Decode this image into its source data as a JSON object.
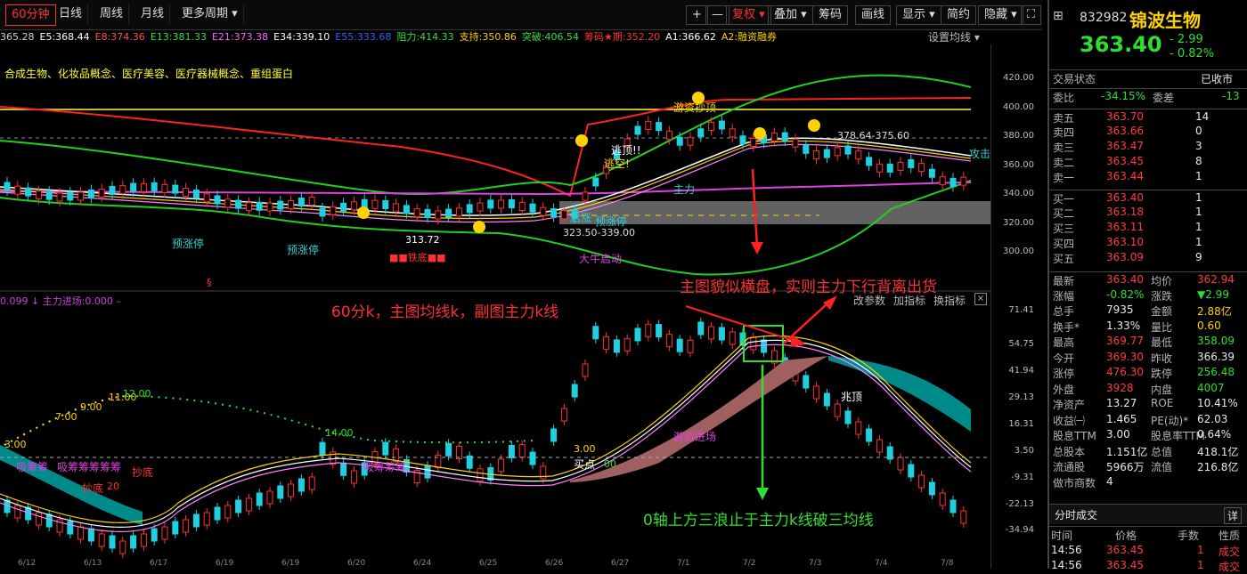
{
  "toolbar": {
    "periods": [
      "60分钟",
      "日线",
      "周线",
      "月线",
      "更多周期 ▾"
    ],
    "buttons": [
      "+",
      "—",
      "复权 ▾",
      "叠加 ▾",
      "筹码",
      "画线",
      "显示 ▾",
      "简约",
      "隐藏 ▾"
    ],
    "colors": {
      "active": "#ff3030"
    }
  },
  "ma_row": [
    {
      "text": "365.28",
      "color": "#d0d0d0"
    },
    {
      "text": "E5:368.44",
      "color": "#ffffff"
    },
    {
      "text": "E8:374.36",
      "color": "#ff5050"
    },
    {
      "text": "E13:381.33",
      "color": "#30e030"
    },
    {
      "text": "E21:373.38",
      "color": "#ff60ff"
    },
    {
      "text": "E34:339.10",
      "color": "#ffffff"
    },
    {
      "text": "E55:333.68",
      "color": "#3060ff"
    },
    {
      "text": "阻力:414.33",
      "color": "#30e030"
    },
    {
      "text": "支持:350.86",
      "color": "#ffd200"
    },
    {
      "text": "突破:406.54",
      "color": "#30e030"
    },
    {
      "text": "筹码★期:352.20",
      "color": "#ff3030"
    },
    {
      "text": "A1:366.62",
      "color": "#ffffff"
    },
    {
      "text": "A2:融资融券",
      "color": "#ffd200"
    }
  ],
  "setting_ma": "设置均线 ▾",
  "concept_text": "合成生物、化妆品概念、医疗美容、医疗器械概念、重组蛋白",
  "main_labels": {
    "yuzhang": "预涨停",
    "yuzhang2": "预涨停",
    "tiedi": "■■铁底■■",
    "low_val": "313.72",
    "range": "323.50-339.00",
    "qidong": "大牛启动",
    "taopao": "逃顶!!",
    "zhuangkong": "逃空!",
    "youzi": "游资抄顶",
    "range2": "378.64-375.60",
    "gongji": "攻击",
    "qizhang": "启涨",
    "yuzhang3": "预涨停",
    "zhuli": "主力",
    "pi": "§"
  },
  "sub_labels": {
    "title": "0.099 ↓ 主力进场:0.000 –",
    "gaicanshu": "改参数",
    "jiazhibiao": "加指标",
    "huanzhibiao": "换指标",
    "xichou": "吸筹筹",
    "xichou2": "吸筹筹筹筹筹",
    "xichou3": "吸筹筹筹",
    "chaodi": "抄底",
    "chaodi2": "抄底",
    "chaodi_val": "20",
    "youzijinchang": "游资进场",
    "maidian": "买点",
    "maidian_val": "00",
    "v300": "3.00",
    "v300b": "3.00",
    "zhaotou": "兆顶",
    "seq1": "3.00",
    "seq2": "7.00",
    "seq3": "9.00",
    "seq4": "11.00",
    "seq5": "12.00",
    "seq6": "14.00"
  },
  "annotations": {
    "a1": "主图貌似横盘，实则主力下行背离出货",
    "a2": "60分k，主图均线k，副图主力k线",
    "a3": "0轴上方三浪止于主力k线破三均线"
  },
  "axis_main": [
    "420.00",
    "400.00",
    "380.00",
    "360.00",
    "340.00",
    "320.00",
    "300.00"
  ],
  "axis_sub": [
    "71.41",
    "54.75",
    "41.94",
    "29.13",
    "16.31",
    "3.50",
    "-9.31",
    "-22.13",
    "-34.94"
  ],
  "dates": [
    "6/12",
    "6/13",
    "6/17",
    "6/19",
    "6/19",
    "6/20",
    "6/24",
    "6/25",
    "6/26",
    "6/27",
    "7/1",
    "7/2",
    "7/3",
    "7/4",
    "7/8"
  ],
  "stock": {
    "code": "832982",
    "name": "锦波生物",
    "price": "363.40",
    "change": "- 2.99",
    "pct": "- 0.82%",
    "status_label": "交易状态",
    "status": "已收市"
  },
  "weibi": {
    "l1": "委比",
    "v1": "-34.15%",
    "l2": "委差",
    "v2": "-13"
  },
  "asks": [
    {
      "label": "卖五",
      "price": "363.70",
      "vol": "14"
    },
    {
      "label": "卖四",
      "price": "363.66",
      "vol": "0"
    },
    {
      "label": "卖三",
      "price": "363.47",
      "vol": "3"
    },
    {
      "label": "卖二",
      "price": "363.45",
      "vol": "8"
    },
    {
      "label": "卖一",
      "price": "363.44",
      "vol": "1"
    }
  ],
  "bids": [
    {
      "label": "买一",
      "price": "363.40",
      "vol": "1"
    },
    {
      "label": "买二",
      "price": "363.18",
      "vol": "1"
    },
    {
      "label": "买三",
      "price": "363.11",
      "vol": "1"
    },
    {
      "label": "买四",
      "price": "363.10",
      "vol": "1"
    },
    {
      "label": "买五",
      "price": "363.09",
      "vol": "9"
    }
  ],
  "quote": [
    {
      "l1": "最新",
      "v1": "363.40",
      "c1": "red",
      "l2": "均价",
      "v2": "362.94",
      "c2": "red"
    },
    {
      "l1": "涨幅",
      "v1": "-0.82%",
      "c1": "green",
      "l2": "涨跌",
      "v2": "▼2.99",
      "c2": "green"
    },
    {
      "l1": "总手",
      "v1": "7935",
      "c1": "wht",
      "l2": "金额",
      "v2": "2.88亿",
      "c2": "yel"
    },
    {
      "l1": "换手*",
      "v1": "1.33%",
      "c1": "wht",
      "l2": "量比",
      "v2": "0.60",
      "c2": "yel"
    },
    {
      "l1": "最高",
      "v1": "369.77",
      "c1": "red",
      "l2": "最低",
      "v2": "358.09",
      "c2": "green"
    },
    {
      "l1": "今开",
      "v1": "369.30",
      "c1": "red",
      "l2": "昨收",
      "v2": "366.39",
      "c2": "wht"
    },
    {
      "l1": "涨停",
      "v1": "476.30",
      "c1": "red",
      "l2": "跌停",
      "v2": "256.48",
      "c2": "green"
    },
    {
      "l1": "外盘",
      "v1": "3928",
      "c1": "red",
      "l2": "内盘",
      "v2": "4007",
      "c2": "green"
    },
    {
      "l1": "净资产",
      "v1": "13.27",
      "c1": "wht",
      "l2": "ROE",
      "v2": "10.41%",
      "c2": "wht"
    },
    {
      "l1": "收益㈠",
      "v1": "1.465",
      "c1": "wht",
      "l2": "PE(动)*",
      "v2": "62.03",
      "c2": "wht"
    },
    {
      "l1": "股息TTM",
      "v1": "3.00",
      "c1": "wht",
      "l2": "股息率TTM",
      "v2": "0.64%",
      "c2": "wht"
    },
    {
      "l1": "总股本",
      "v1": "1.151亿",
      "c1": "wht",
      "l2": "总值",
      "v2": "418.1亿",
      "c2": "wht"
    },
    {
      "l1": "流通股",
      "v1": "5966万",
      "c1": "wht",
      "l2": "流值",
      "v2": "216.8亿",
      "c2": "wht"
    },
    {
      "l1": "做市商数",
      "v1": "4",
      "c1": "wht",
      "l2": "",
      "v2": "",
      "c2": "wht"
    }
  ],
  "fenshi": {
    "title": "分时成交",
    "more": "详",
    "h_time": "时间",
    "h_price": "价格",
    "h_vol": "手数",
    "h_nature": "性质",
    "rows": [
      {
        "time": "14:56",
        "price": "363.45",
        "vol": "1",
        "nat": "成交"
      },
      {
        "time": "14:56",
        "price": "363.45",
        "vol": "1",
        "nat": "成交"
      }
    ]
  }
}
